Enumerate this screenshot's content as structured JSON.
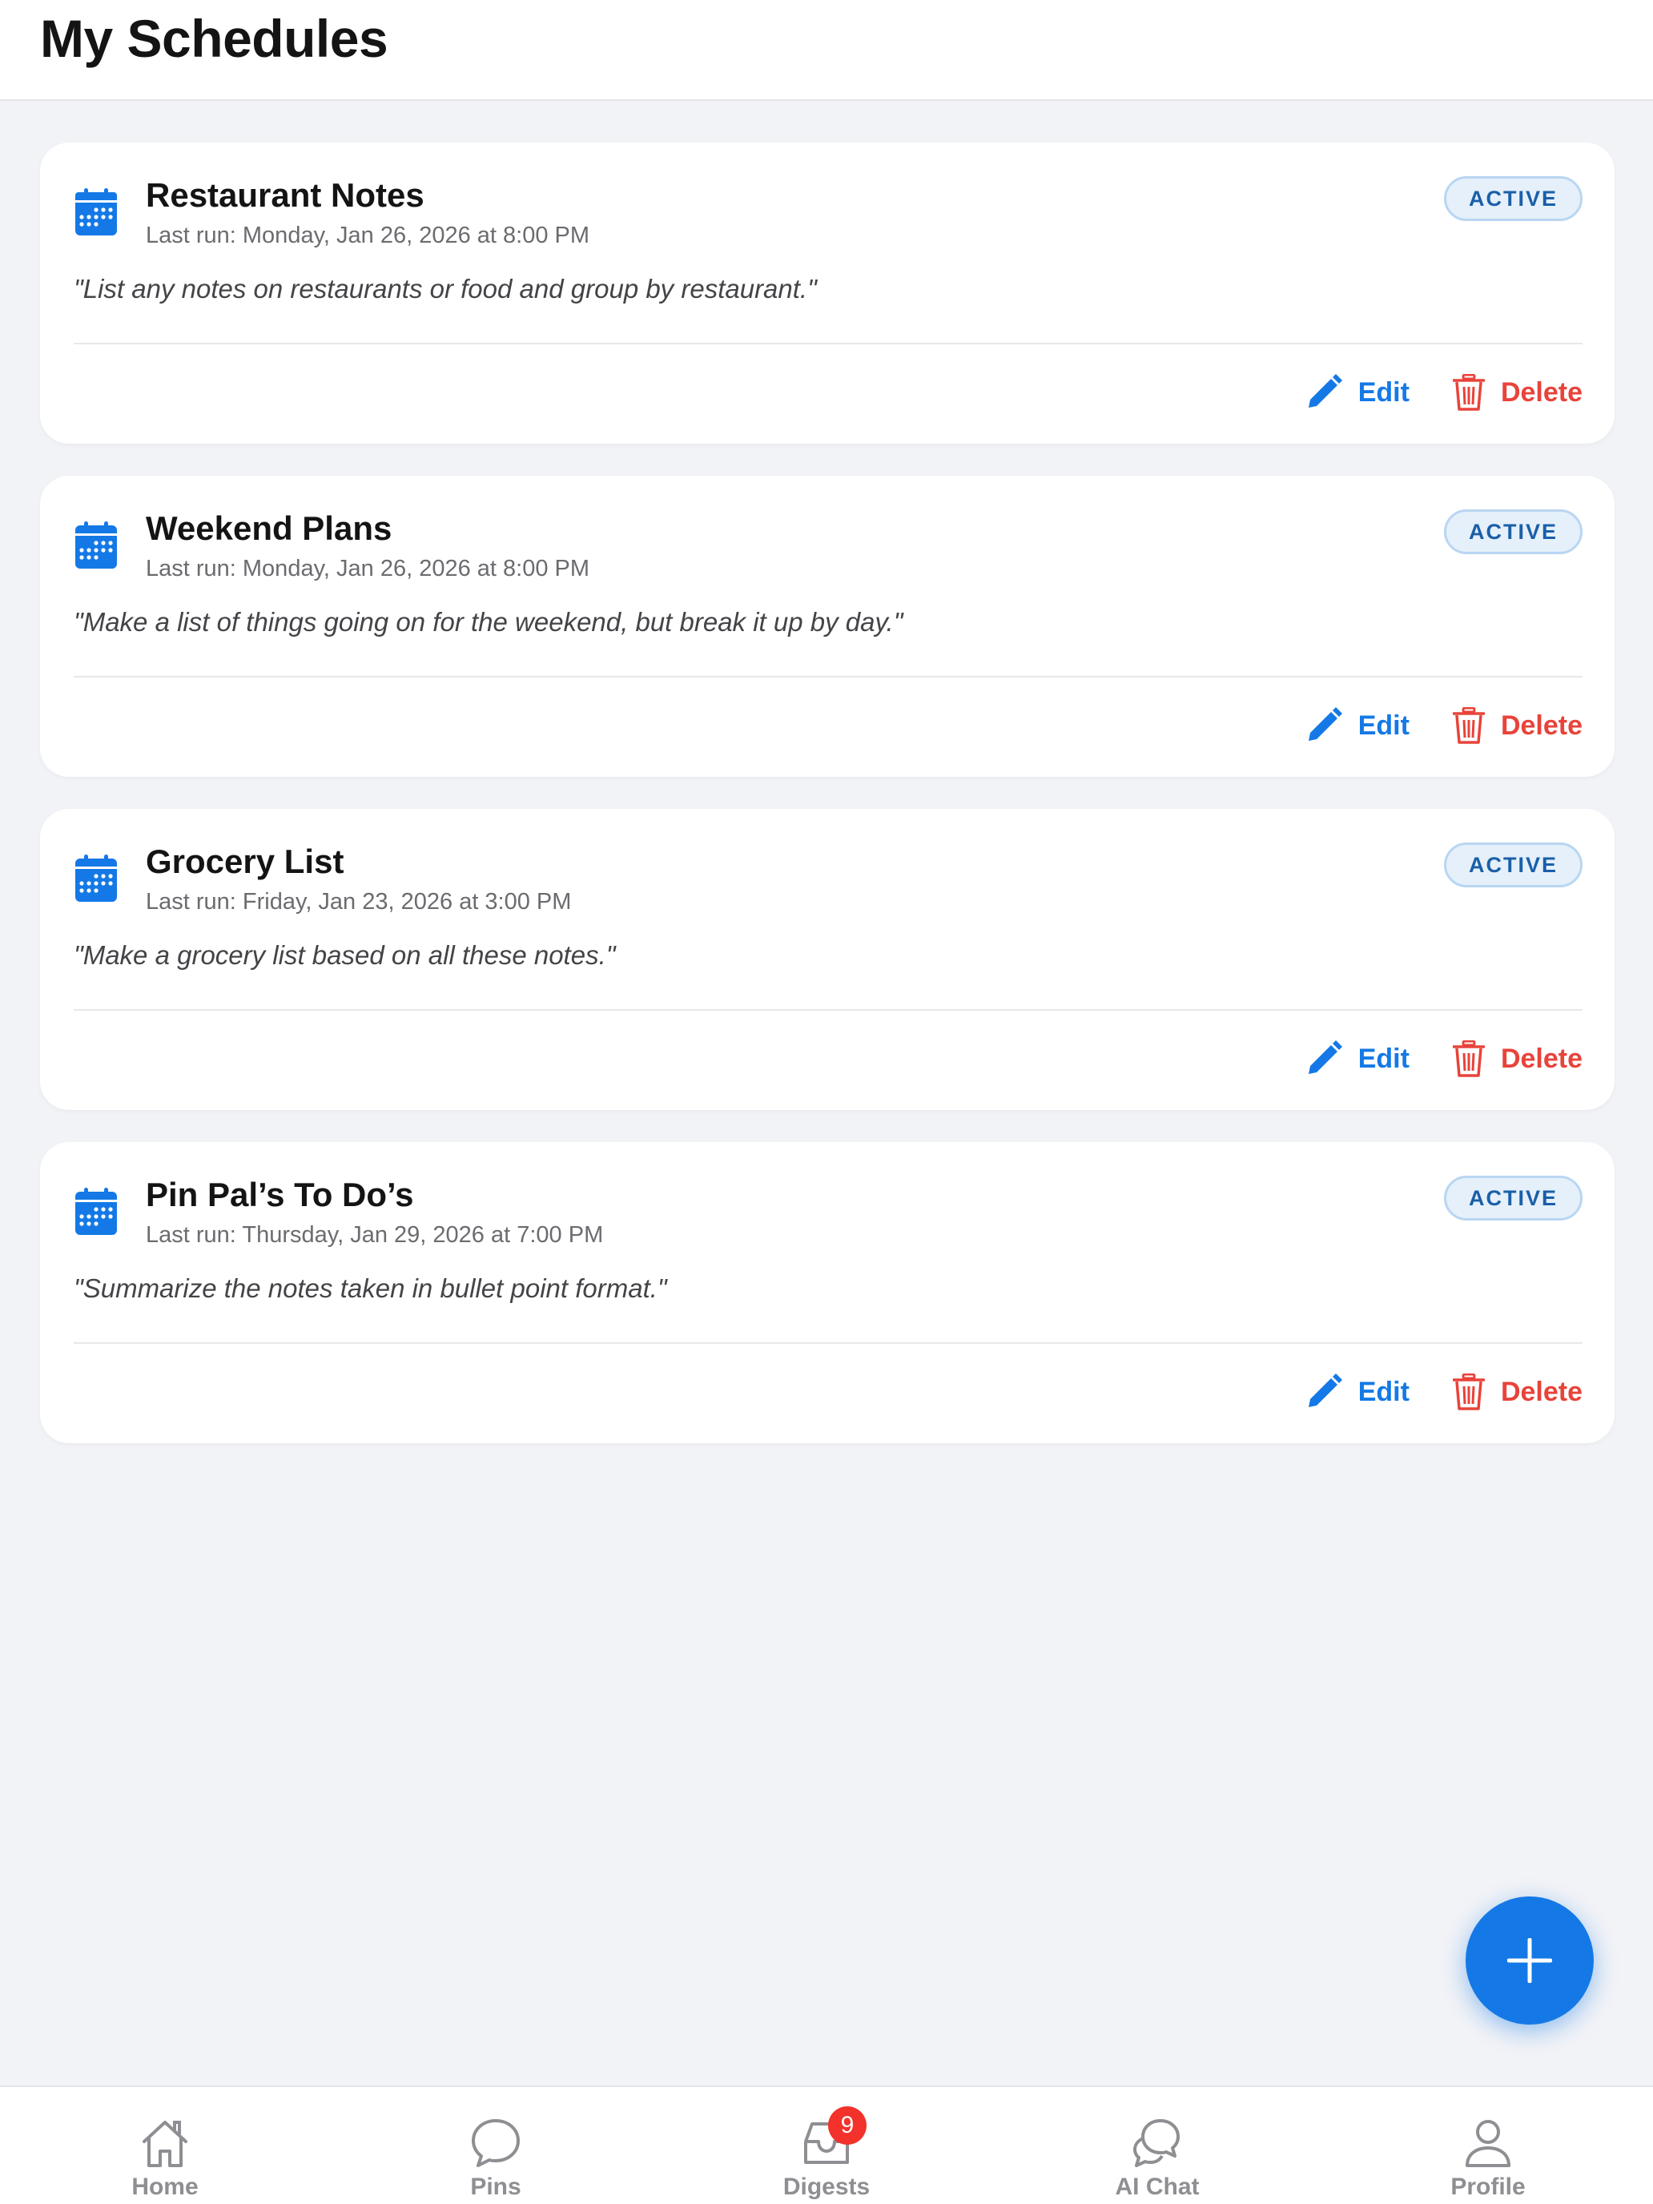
{
  "header": {
    "title": "My Schedules"
  },
  "schedules": [
    {
      "title": "Restaurant Notes",
      "last_run": "Last run: Monday, Jan 26, 2026 at 8:00 PM",
      "status": "ACTIVE",
      "prompt": "\"List any notes on restaurants or food and group by restaurant.\"",
      "edit_label": "Edit",
      "delete_label": "Delete"
    },
    {
      "title": "Weekend Plans",
      "last_run": "Last run: Monday, Jan 26, 2026 at 8:00 PM",
      "status": "ACTIVE",
      "prompt": "\"Make a list of things going on for the weekend, but break it up by day.\"",
      "edit_label": "Edit",
      "delete_label": "Delete"
    },
    {
      "title": "Grocery List",
      "last_run": "Last run: Friday, Jan 23, 2026 at 3:00 PM",
      "status": "ACTIVE",
      "prompt": "\"Make a grocery list based on all these notes.\"",
      "edit_label": "Edit",
      "delete_label": "Delete"
    },
    {
      "title": "Pin Pal’s To Do’s",
      "last_run": "Last run: Thursday, Jan 29, 2026 at 7:00 PM",
      "status": "ACTIVE",
      "prompt": "\"Summarize the notes taken in bullet point format.\"",
      "edit_label": "Edit",
      "delete_label": "Delete"
    }
  ],
  "fab": {
    "icon": "plus-icon"
  },
  "tabbar": {
    "items": [
      {
        "label": "Home",
        "icon": "home-icon"
      },
      {
        "label": "Pins",
        "icon": "chat-bubble-icon"
      },
      {
        "label": "Digests",
        "icon": "inbox-tray-icon",
        "badge": "9"
      },
      {
        "label": "AI Chat",
        "icon": "chat-bubbles-icon"
      },
      {
        "label": "Profile",
        "icon": "person-icon"
      }
    ]
  },
  "colors": {
    "accent": "#1479e6",
    "danger": "#e8433a",
    "badge_bg": "#e5f0fb",
    "badge_text": "#1a5fa8",
    "notification": "#f2322b",
    "background": "#f2f3f7"
  }
}
